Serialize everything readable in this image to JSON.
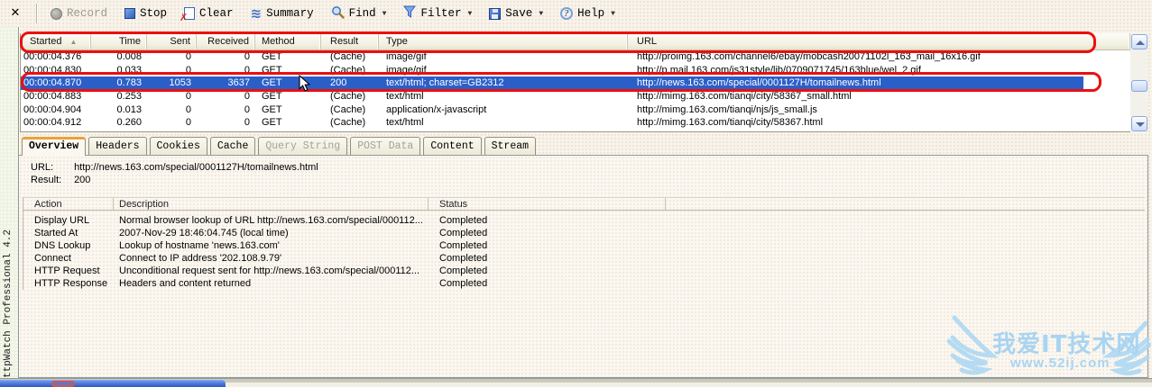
{
  "window": {
    "close_glyph": "✕",
    "side_caption": "ttpWatch Professional 4.2"
  },
  "toolbar": {
    "record": "Record",
    "stop": "Stop",
    "clear": "Clear",
    "summary": "Summary",
    "find": "Find",
    "filter": "Filter",
    "save": "Save",
    "help": "Help"
  },
  "request_grid": {
    "columns": [
      "Started",
      "Time",
      "Sent",
      "Received",
      "Method",
      "Result",
      "Type",
      "URL"
    ],
    "sort_column": "Started",
    "rows": [
      {
        "started": "00:00:04.376",
        "time": "0.008",
        "sent": "0",
        "received": "0",
        "method": "GET",
        "result": "(Cache)",
        "type": "image/gif",
        "url": "http://proimg.163.com/channel6/ebay/mobcash20071102l_163_mail_16x16.gif"
      },
      {
        "started": "00:00:04.830",
        "time": "0.033",
        "sent": "0",
        "received": "0",
        "method": "GET",
        "result": "(Cache)",
        "type": "image/gif",
        "url": "http://p.mail.163.com/js31style/lib/0709071745/163blue/wel_2.gif"
      },
      {
        "started": "00:00:04.870",
        "time": "0.783",
        "sent": "1053",
        "received": "3637",
        "method": "GET",
        "result": "200",
        "type": "text/html; charset=GB2312",
        "url": "http://news.163.com/special/0001127H/tomailnews.html",
        "selected": true
      },
      {
        "started": "00:00:04.883",
        "time": "0.253",
        "sent": "0",
        "received": "0",
        "method": "GET",
        "result": "(Cache)",
        "type": "text/html",
        "url": "http://mimg.163.com/tianqi/city/58367_small.html"
      },
      {
        "started": "00:00:04.904",
        "time": "0.013",
        "sent": "0",
        "received": "0",
        "method": "GET",
        "result": "(Cache)",
        "type": "application/x-javascript",
        "url": "http://mimg.163.com/tianqi/njs/js_small.js"
      },
      {
        "started": "00:00:04.912",
        "time": "0.260",
        "sent": "0",
        "received": "0",
        "method": "GET",
        "result": "(Cache)",
        "type": "text/html",
        "url": "http://mimg.163.com/tianqi/city/58367.html"
      }
    ]
  },
  "tabs": [
    {
      "label": "Overview",
      "state": "active"
    },
    {
      "label": "Headers",
      "state": "normal"
    },
    {
      "label": "Cookies",
      "state": "normal"
    },
    {
      "label": "Cache",
      "state": "normal"
    },
    {
      "label": "Query String",
      "state": "disabled"
    },
    {
      "label": "POST Data",
      "state": "disabled"
    },
    {
      "label": "Content",
      "state": "normal"
    },
    {
      "label": "Stream",
      "state": "normal"
    }
  ],
  "overview": {
    "url_label": "URL:",
    "url_value": "http://news.163.com/special/0001127H/tomailnews.html",
    "result_label": "Result:",
    "result_value": "200"
  },
  "action_table": {
    "columns": [
      "Action",
      "Description",
      "Status"
    ],
    "rows": [
      {
        "action": "Display URL",
        "description": "Normal browser lookup of URL http://news.163.com/special/000112...",
        "status": "Completed"
      },
      {
        "action": "Started At",
        "description": "2007-Nov-29 18:46:04.745 (local time)",
        "status": "Completed"
      },
      {
        "action": "DNS Lookup",
        "description": "Lookup of hostname 'news.163.com'",
        "status": "Completed"
      },
      {
        "action": "Connect",
        "description": "Connect to IP address '202.108.9.79'",
        "status": "Completed"
      },
      {
        "action": "HTTP Request",
        "description": "Unconditional request sent for http://news.163.com/special/000112...",
        "status": "Completed"
      },
      {
        "action": "HTTP Response",
        "description": "Headers and content returned",
        "status": "Completed"
      }
    ]
  },
  "watermark": {
    "title": "我爱IT技术网",
    "url": "www.52ij.com",
    "color": "#a8d4f2"
  },
  "annotation_color": "#ec0f0f",
  "selection_color": "#2b5fc8"
}
